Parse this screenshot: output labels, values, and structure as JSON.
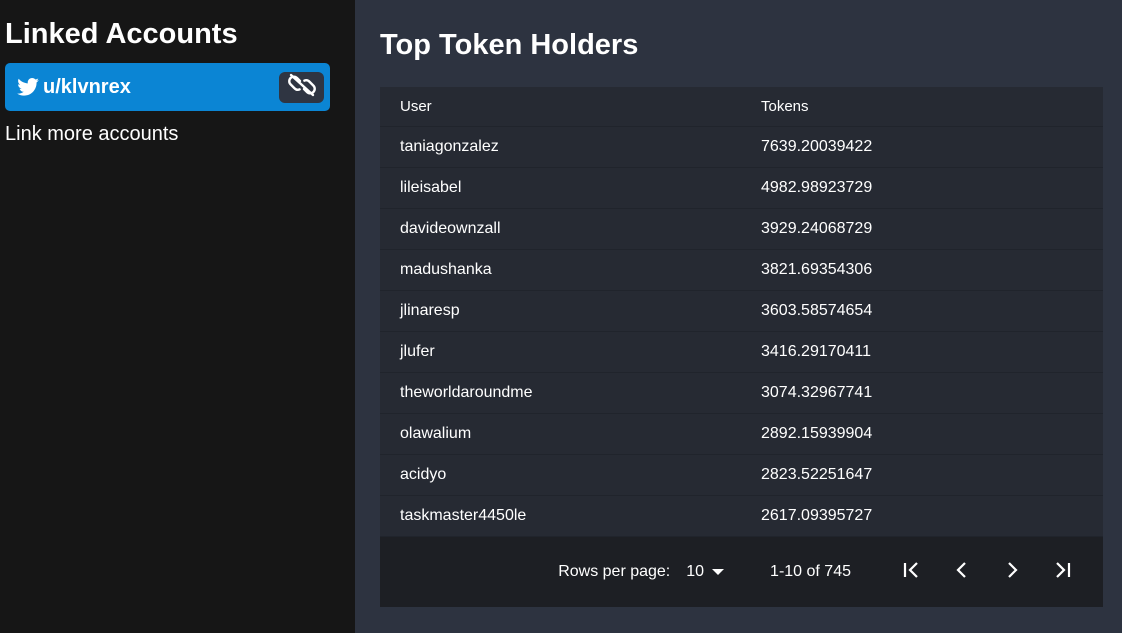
{
  "sidebar": {
    "title": "Linked Accounts",
    "account": {
      "name": "u/klvnrex",
      "icon": "twitter-icon",
      "action_icon": "unlink-icon"
    },
    "link_more": "Link more accounts"
  },
  "main": {
    "title": "Top Token Holders",
    "columns": [
      "User",
      "Tokens"
    ],
    "rows": [
      [
        "taniagonzalez",
        "7639.20039422"
      ],
      [
        "lileisabel",
        "4982.98923729"
      ],
      [
        "davideownzall",
        "3929.24068729"
      ],
      [
        "madushanka",
        "3821.69354306"
      ],
      [
        "jlinaresp",
        "3603.58574654"
      ],
      [
        "jlufer",
        "3416.29170411"
      ],
      [
        "theworldaroundme",
        "3074.32967741"
      ],
      [
        "olawalium",
        "2892.15939904"
      ],
      [
        "acidyo",
        "2823.52251647"
      ],
      [
        "taskmaster4450le",
        "2617.09395727"
      ]
    ],
    "pager": {
      "rows_per_page_label": "Rows per page:",
      "rows_per_page_value": "10",
      "range": "1-10 of 745"
    }
  },
  "colors": {
    "accent": "#0b85d4",
    "sidebar_bg": "#161616",
    "main_bg": "#2d3340"
  }
}
